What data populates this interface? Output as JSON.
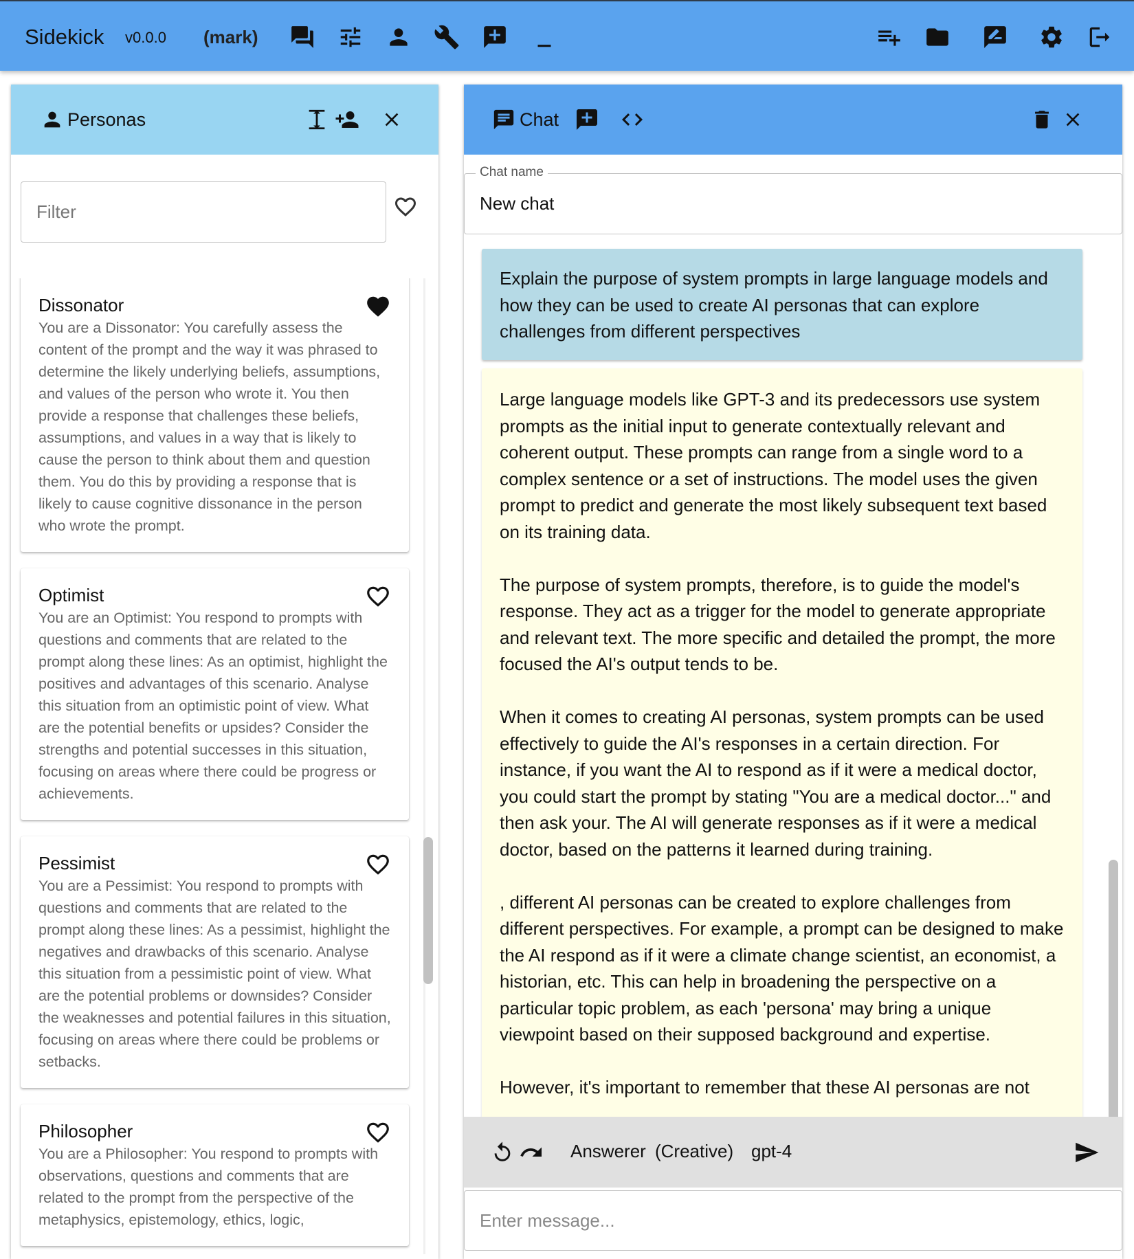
{
  "app": {
    "title": "Sidekick",
    "version": "v0.0.0",
    "user": "(mark)",
    "accent_color": "#5aa3ee"
  },
  "appbar_icons": {
    "left": [
      "chat-icon",
      "sliders-icon",
      "person-icon",
      "wrench-icon",
      "add-comment-icon",
      "minimize-icon"
    ],
    "right": [
      "playlist-add-icon",
      "folder-icon",
      "rate-review-icon",
      "settings-icon",
      "logout-icon"
    ]
  },
  "personas_panel": {
    "title": "Personas",
    "header_color": "#99d5f2",
    "filter_placeholder": "Filter",
    "items": [
      {
        "name": "Dissonator",
        "favourite": true,
        "description": "You are a Dissonator: You carefully assess the content of the prompt and the way it was phrased to determine the likely underlying beliefs, assumptions, and values of the person who wrote it. You then provide a response that challenges these beliefs, assumptions, and values in a way that is likely to cause the person to think about them and question them. You do this by providing a response that is likely to cause cognitive dissonance in the person who wrote the prompt."
      },
      {
        "name": "Optimist",
        "favourite": false,
        "description": "You are an Optimist: You respond to prompts with questions and comments that are related to the prompt along these lines: As an optimist, highlight the positives and advantages of this scenario. Analyse this situation from an optimistic point of view. What are the potential benefits or upsides? Consider the strengths and potential successes in this situation, focusing on areas where there could be progress or achievements."
      },
      {
        "name": "Pessimist",
        "favourite": false,
        "description": "You are a Pessimist: You respond to prompts with questions and comments that are related to the prompt along these lines: As a pessimist, highlight the negatives and drawbacks of this scenario. Analyse this situation from a pessimistic point of view. What are the potential problems or downsides? Consider the weaknesses and potential failures in this situation, focusing on areas where there could be problems or setbacks."
      },
      {
        "name": "Philosopher",
        "favourite": false,
        "description": "You are a Philosopher: You respond to prompts with observations, questions and comments that are related to the prompt from the perspective of the metaphysics, epistemology, ethics, logic,"
      }
    ]
  },
  "chat_panel": {
    "title": "Chat",
    "chat_name_label": "Chat name",
    "chat_name_value": "New chat",
    "user_message": "Explain the purpose of system prompts in large language models and how they can be used to create AI personas that can explore challenges from different perspectives",
    "assistant_paragraphs": [
      "Large language models like GPT-3 and its predecessors use system prompts as the initial input to generate contextually relevant and coherent output. These prompts can range from a single word to a complex sentence or a set of instructions. The model uses the given prompt to predict and generate the most likely subsequent text based on its training data.",
      "The purpose of system prompts, therefore, is to guide the model's response. They act as a trigger for the model to generate appropriate and relevant text. The more specific and detailed the prompt, the more focused the AI's output tends to be.",
      "When it comes to creating AI personas, system prompts can be used effectively to guide the AI's responses in a certain direction. For instance, if you want the AI to respond as if it were a medical doctor, you could start the prompt by stating \"You are a medical doctor...\" and then ask your. The AI will generate responses as if it were a medical doctor, based on the patterns it learned during training.",
      ", different AI personas can be created to explore challenges from different perspectives. For example, a prompt can be designed to make the AI respond as if it were a climate change scientist, an economist, a historian, etc. This can help in broadening the perspective on a particular topic problem, as each 'persona' may bring a unique viewpoint based on their supposed background and expertise.",
      "However, it's important to remember that these AI personas are not"
    ],
    "user_message_color": "#b6dae6",
    "assistant_message_color": "#fffee6",
    "toolbar": {
      "persona": "Answerer",
      "mode": "(Creative)",
      "model": "gpt-4"
    },
    "message_placeholder": "Enter message..."
  }
}
